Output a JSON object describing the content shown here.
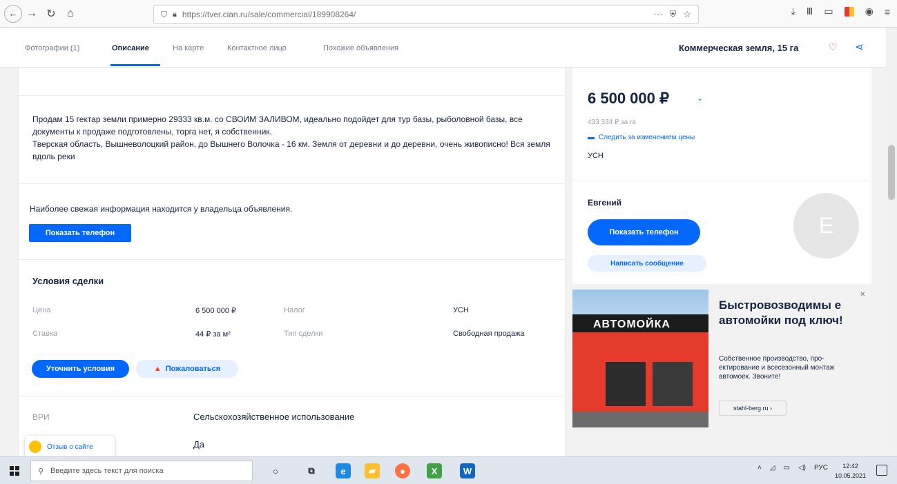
{
  "browser": {
    "url": "https://tver.cian.ru/sale/commercial/189908264/",
    "back_icon": "←",
    "forward_icon": "→",
    "reload_icon": "↻",
    "home_icon": "⌂",
    "more_icon": "···"
  },
  "tabs": {
    "items": [
      {
        "label": "Фотографии (1)"
      },
      {
        "label": "Описание"
      },
      {
        "label": "На карте"
      },
      {
        "label": "Контактное лицо"
      },
      {
        "label": "Похожие объявления"
      }
    ],
    "listing_title": "Коммерческая земля, 15 га"
  },
  "description": {
    "text": "Продам 15 гектар земли примерно 29333 кв.м. со СВОИМ ЗАЛИВОМ, идеально подойдет для тур базы, рыболовной базы, все документы к продаже подготовлены, торга нет, я собственник.\nТверская область, Вышневолоцкий район, до Вышнего Волочка - 16 км. Земля от деревни и до деревни, очень живописно! Вся земля вдоль реки"
  },
  "contact_info": {
    "text": "Наиболее свежая информация находится у владельца объявления.",
    "phone_button": "Показать телефон"
  },
  "deal": {
    "title": "Условия сделки",
    "price_label": "Цена",
    "price_value": "6 500 000 ₽",
    "tax_label": "Налог",
    "tax_value": "УСН",
    "rate_label": "Ставка",
    "rate_value": "44 ₽ за м²",
    "type_label": "Тип сделки",
    "type_value": "Свободная продажа",
    "clarify_button": "Уточнить условия",
    "complain_button": "Пожаловаться"
  },
  "vri": {
    "label": "ВРИ",
    "value": "Сельскохозяйственное использование",
    "second_value": "Да"
  },
  "feedback": {
    "label": "Отзыв о сайте"
  },
  "price_card": {
    "price": "6 500 000 ₽",
    "per_ha": "433 334 ₽ за га",
    "follow": "Следить за изменением цены",
    "tax": "УСН"
  },
  "contact_card": {
    "name": "Евгений",
    "phone_button": "Показать телефон",
    "message_button": "Написать сообщение",
    "avatar_letter": "Е"
  },
  "ad": {
    "sign": "АВТОМОЙКА",
    "headline": "Быстровозводимы е автомойки под ключ!",
    "body": "Собственное производство, про-ектирование и всесезонный монтаж автомоек. Звоните!",
    "link": "stahl-berg.ru ›"
  },
  "taskbar": {
    "search_placeholder": "Введите здесь текст для поиска",
    "lang": "РУС",
    "time": "12:42",
    "date": "10.05.2021"
  }
}
